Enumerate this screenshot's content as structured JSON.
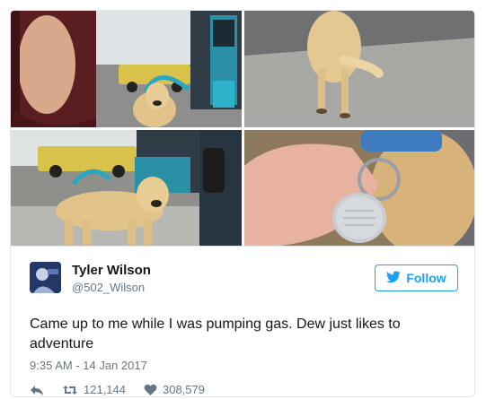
{
  "tweet": {
    "author_name": "Tyler Wilson",
    "author_handle": "@502_Wilson",
    "follow_label": "Follow",
    "text": "Came up to me while I was pumping gas. Dew just likes to adventure",
    "timestamp": "9:35 AM - 14 Jan 2017",
    "retweets": "121,144",
    "likes": "308,579"
  },
  "icons": {
    "follow": "bird-icon",
    "reply": "reply-icon",
    "retweet": "retweet-icon",
    "like": "heart-icon"
  },
  "colors": {
    "accent": "#1da1f2",
    "secondary_text": "#657786",
    "border": "#e1e8ed"
  }
}
